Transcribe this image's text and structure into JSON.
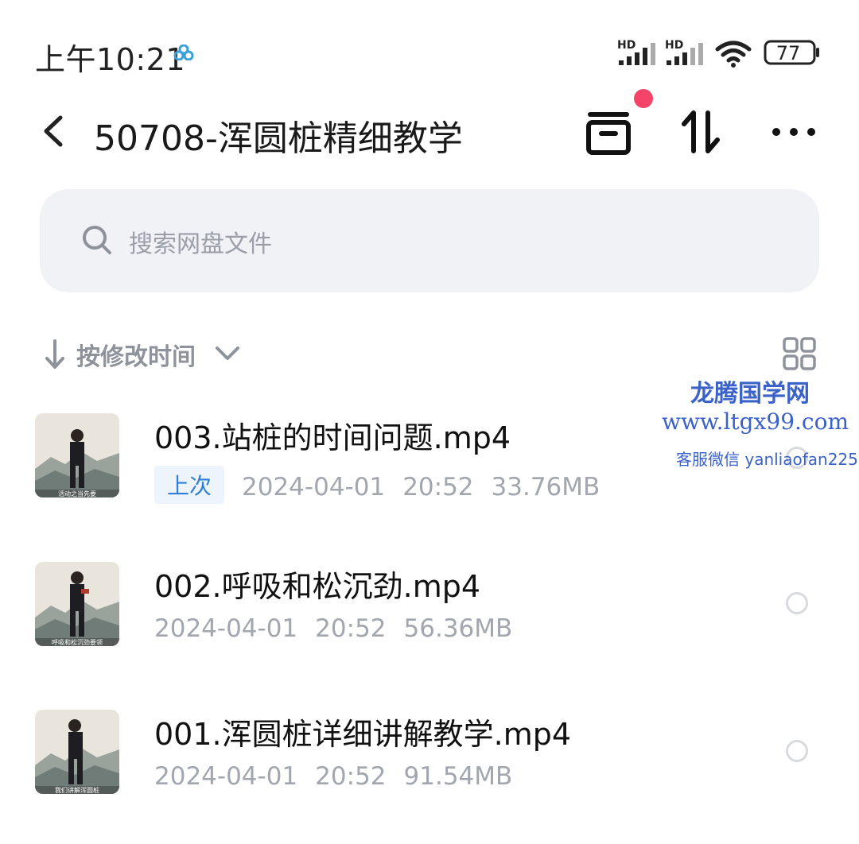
{
  "status": {
    "time": "上午10:21",
    "signal1": "HD",
    "signal2": "HD",
    "battery": "77"
  },
  "header": {
    "title": "50708-浑圆桩精细教学"
  },
  "search": {
    "placeholder": "搜索网盘文件"
  },
  "sort": {
    "label": "按修改时间"
  },
  "files": [
    {
      "name": "003.站桩的时间问题.mp4",
      "badge": "上次",
      "date": "2024-04-01",
      "time": "20:52",
      "size": "33.76MB",
      "caption": "活动之当先要"
    },
    {
      "name": "002.呼吸和松沉劲.mp4",
      "date": "2024-04-01",
      "time": "20:52",
      "size": "56.36MB",
      "caption": "呼吸和松沉劲要领"
    },
    {
      "name": "001.浑圆桩详细讲解教学.mp4",
      "date": "2024-04-01",
      "time": "20:52",
      "size": "91.54MB",
      "caption": "我们讲解浑圆桩"
    }
  ],
  "watermark": {
    "title": "龙腾国学网",
    "url": "www.ltgx99.com",
    "contact": "客服微信 yanliaofan225"
  },
  "colors": {
    "accent_blue": "#2f7fd6",
    "notification_red": "#f5446a",
    "search_bg": "#f1f2f6",
    "watermark_blue": "#3a62c8"
  }
}
